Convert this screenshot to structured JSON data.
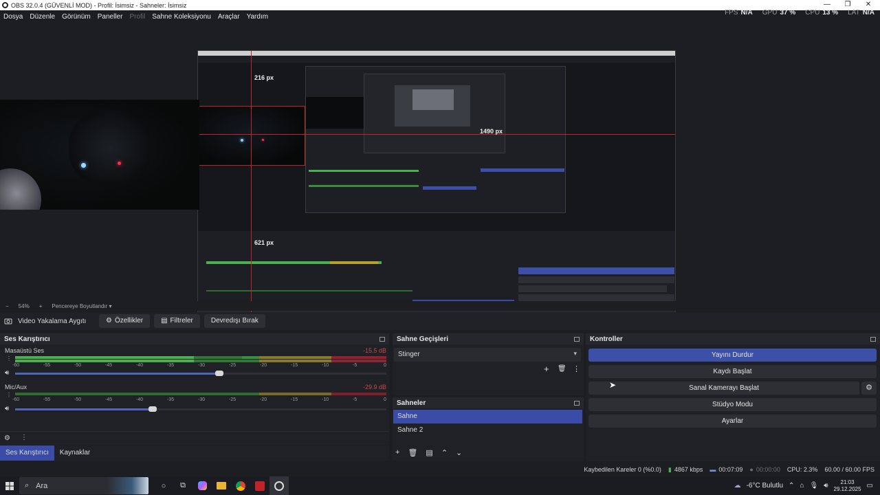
{
  "window": {
    "title": "OBS 32.0.4 (GÜVENLİ MOD) - Profil: İsimsiz - Sahneler: İsimsiz"
  },
  "menu": [
    "Dosya",
    "Düzenle",
    "Görünüm",
    "Paneller",
    "Profil",
    "Sahne Koleksiyonu",
    "Araçlar",
    "Yardım"
  ],
  "stats": {
    "fps_label": "FPS",
    "fps_value": "N/A",
    "gpu_label": "GPU",
    "gpu_value": "37 %",
    "cpu_label": "CPU",
    "cpu_value": "13 %",
    "lat_label": "LAT",
    "lat_value": "N/A"
  },
  "preview": {
    "label_top": "216 px",
    "label_right": "1490 px",
    "label_bottom": "621 px"
  },
  "zoom": {
    "minus": "−",
    "value": "54%",
    "plus": "+",
    "mode": "Pencereye Boyutlandır"
  },
  "source_toolbar": {
    "source_name": "Video Yakalama Aygıtı",
    "properties": "Özellikler",
    "filters": "Filtreler",
    "deactivate": "Devredışı Bırak"
  },
  "mixer": {
    "title": "Ses Karıştırıcı",
    "channels": [
      {
        "name": "Masaüstü Ses",
        "db": "-15.5 dB",
        "level": 0.64,
        "volume": 0.55
      },
      {
        "name": "Mic/Aux",
        "db": "-29.9 dB",
        "level": 0.0,
        "volume": 0.37
      }
    ],
    "scale": [
      "-60",
      "-55",
      "-50",
      "-45",
      "-40",
      "-35",
      "-30",
      "-25",
      "-20",
      "-15",
      "-10",
      "-5",
      "0"
    ]
  },
  "transitions": {
    "title": "Sahne Geçişleri",
    "selected": "Stinger"
  },
  "scenes": {
    "title": "Sahneler",
    "items": [
      "Sahne",
      "Sahne 2"
    ]
  },
  "controls": {
    "title": "Kontroller",
    "stop_stream": "Yayını Durdur",
    "start_record": "Kaydı Başlat",
    "start_vcam": "Sanal Kamerayı Başlat",
    "studio_mode": "Stüdyo Modu",
    "settings": "Ayarlar"
  },
  "tabs": [
    "Ses Karıştırıcı",
    "Kaynaklar"
  ],
  "statusbar": {
    "dropped": "Kaybedilen Kareler 0 (%0.0)",
    "bitrate": "4867 kbps",
    "stream_time": "00:07:09",
    "record_time": "00:00:00",
    "cpu": "CPU: 2.3%",
    "fps": "60.00 / 60.00 FPS"
  },
  "taskbar": {
    "search": "Ara",
    "weather": "-6°C  Bulutlu",
    "time": "21:03",
    "date": "29.12.2025"
  },
  "colors": {
    "accent": "#3a4ca6",
    "meter_green": "#4caf50",
    "meter_yellow": "#b8a22e",
    "meter_red": "#b32c3a",
    "guide_red": "#c0232a"
  }
}
